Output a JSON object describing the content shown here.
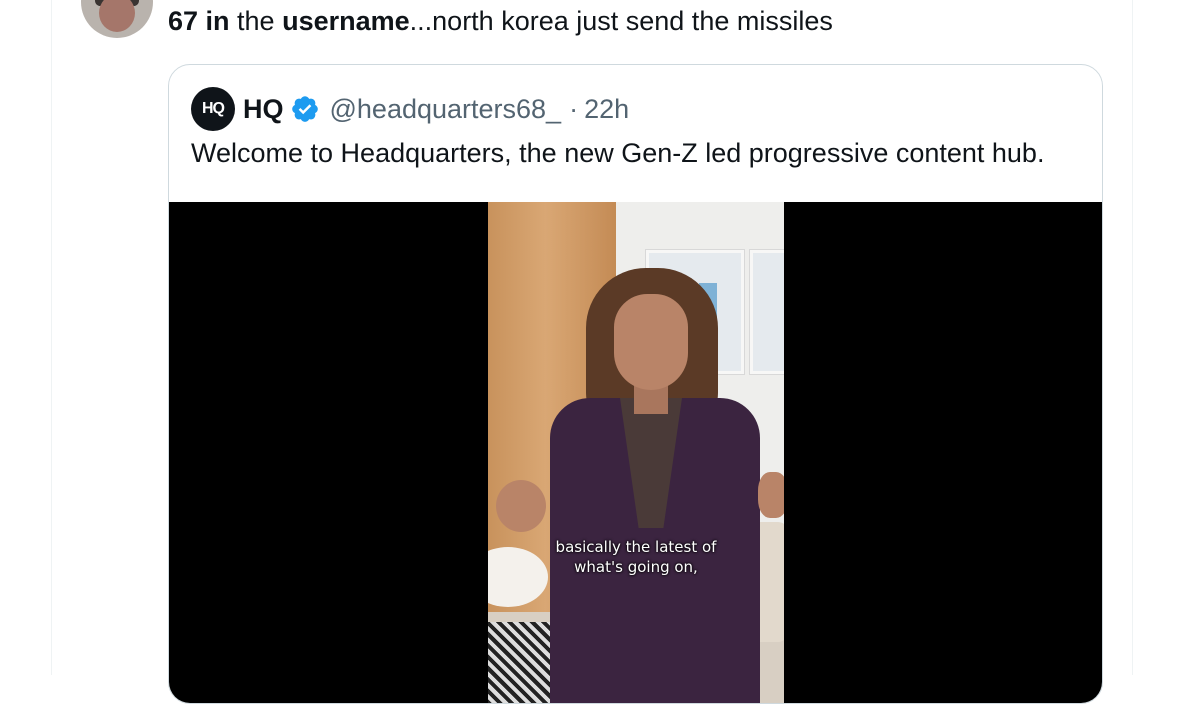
{
  "tweet": {
    "text_bold_1": "67 in",
    "text_plain_1": " the ",
    "text_bold_2": "username",
    "text_plain_2": "...north korea just send the missiles"
  },
  "quoted": {
    "logo_text": "HQ",
    "name": "HQ",
    "handle": "@headquarters68_",
    "separator": "·",
    "time": "22h",
    "text": "Welcome to Headquarters, the new Gen-Z led progressive content hub.",
    "video": {
      "caption_line1": "basically the latest of",
      "caption_line2": "what's going on,"
    }
  },
  "colors": {
    "text": "#0f1419",
    "secondary": "#536471",
    "verified": "#1d9bf0",
    "border": "#cfd9de"
  },
  "icons": {
    "verified": "verified-badge-icon"
  }
}
